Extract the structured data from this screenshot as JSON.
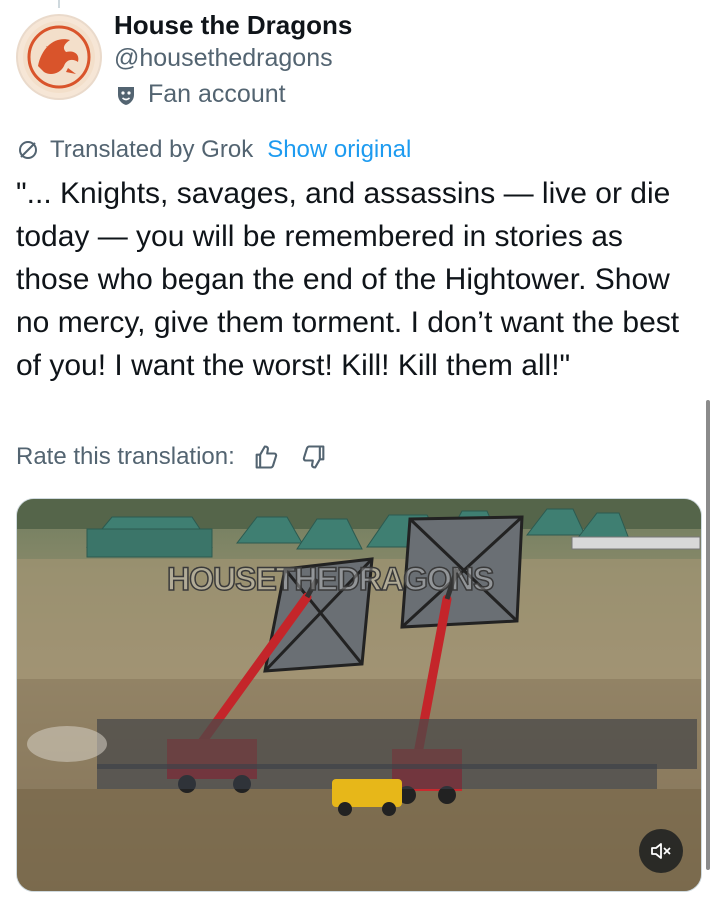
{
  "author": {
    "name": "House the Dragons",
    "handle": "@housethedragons",
    "badge_label": "Fan account"
  },
  "translation": {
    "label": "Translated by Grok",
    "show_original": "Show original",
    "rate_label": "Rate this translation:"
  },
  "tweet": {
    "text": "\"... Knights, savages, and assassins — live or die today — you will be remembered in stories as those who began the end of the Hightower. Show no mercy, give them torment. I don’t want the best of you! I want the worst! Kill! Kill them all!\""
  },
  "media": {
    "watermark": "HOUSETHEDRAGONS",
    "mute_icon": "volume-mute-icon"
  },
  "colors": {
    "accent": "#1d9bf0",
    "secondary_text": "#536471",
    "primary_text": "#0f1419"
  }
}
